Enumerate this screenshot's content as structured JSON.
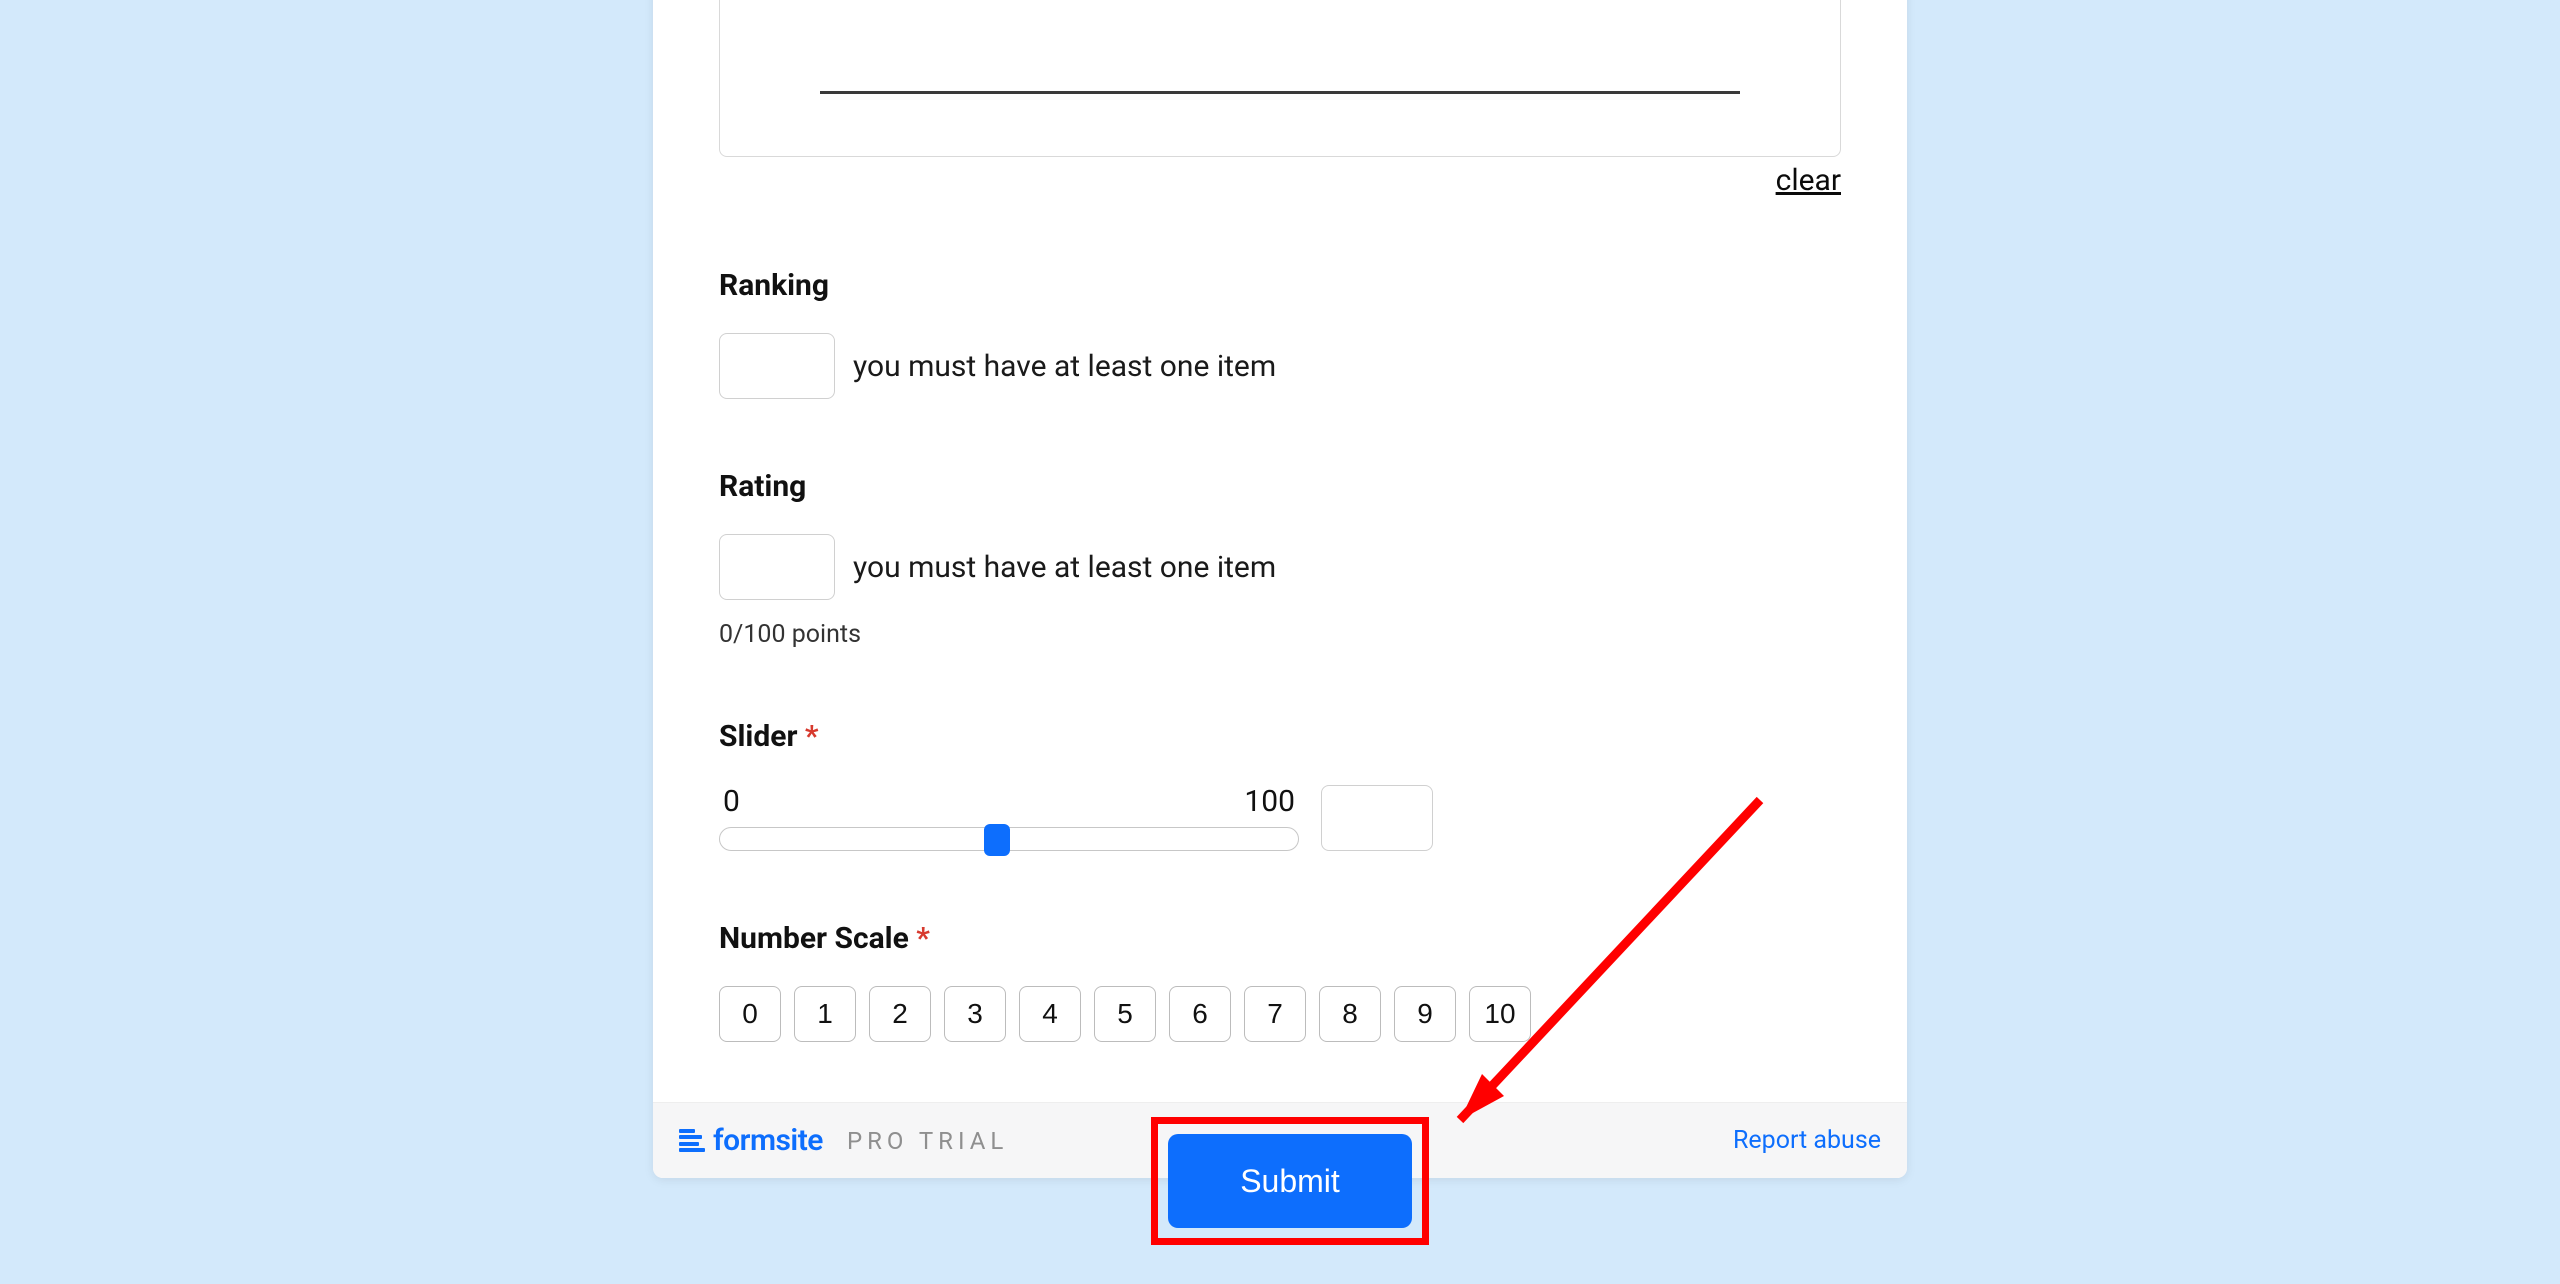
{
  "signature": {
    "clear_label": "clear"
  },
  "ranking": {
    "label": "Ranking",
    "item_text": "you must have at least one item"
  },
  "rating": {
    "label": "Rating",
    "item_text": "you must have at least one item",
    "points_text": "0/100 points"
  },
  "slider": {
    "label": "Slider",
    "required": true,
    "min_label": "0",
    "max_label": "100",
    "position_percent": 48
  },
  "number_scale": {
    "label": "Number Scale",
    "required": true,
    "options": [
      "0",
      "1",
      "2",
      "3",
      "4",
      "5",
      "6",
      "7",
      "8",
      "9",
      "10"
    ]
  },
  "footer": {
    "brand": "formsite",
    "plan": "PRO TRIAL",
    "report_label": "Report abuse"
  },
  "submit": {
    "label": "Submit"
  }
}
